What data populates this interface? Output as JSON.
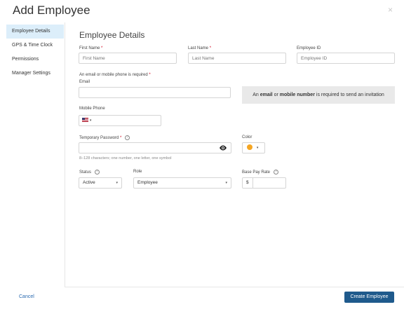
{
  "header": {
    "title": "Add Employee",
    "close_glyph": "×"
  },
  "sidebar": {
    "items": [
      {
        "label": "Employee Details",
        "active": true
      },
      {
        "label": "GPS & Time Clock",
        "active": false
      },
      {
        "label": "Permissions",
        "active": false
      },
      {
        "label": "Manager Settings",
        "active": false
      }
    ]
  },
  "section": {
    "title": "Employee Details"
  },
  "fields": {
    "first_name": {
      "label": "First Name",
      "required_mark": "*",
      "placeholder": "First Name"
    },
    "last_name": {
      "label": "Last Name",
      "required_mark": "*",
      "placeholder": "Last Name"
    },
    "employee_id": {
      "label": "Employee ID",
      "placeholder": "Employee ID"
    },
    "contact_note": {
      "text": "An email or mobile phone is required",
      "required_mark": "*"
    },
    "email": {
      "label": "Email",
      "value": ""
    },
    "info_box": {
      "pre": "An ",
      "email": "email",
      "mid": " or ",
      "mobile": "mobile number",
      "post": " is required to send an invitation"
    },
    "mobile_phone": {
      "label": "Mobile Phone",
      "country_flag": "us-flag-icon",
      "caret": "▾"
    },
    "temporary_password": {
      "label": "Temporary Password",
      "required_mark": "*",
      "help_glyph": "?",
      "hint": "8–128 characters; one number, one letter, one symbol"
    },
    "color": {
      "label": "Color",
      "value_color": "#f5a623",
      "caret": "▾"
    },
    "status": {
      "label": "Status",
      "help_glyph": "?",
      "value": "Active",
      "caret": "▾"
    },
    "role": {
      "label": "Role",
      "value": "Employee",
      "caret": "▾"
    },
    "base_pay_rate": {
      "label": "Base Pay Rate",
      "help_glyph": "?",
      "currency": "$"
    }
  },
  "footer": {
    "cancel_label": "Cancel",
    "create_label": "Create Employee"
  },
  "colors": {
    "accent": "#1f5a8c",
    "link": "#2a6ab0",
    "active_nav": "#dceefa",
    "required": "#d0021b"
  }
}
